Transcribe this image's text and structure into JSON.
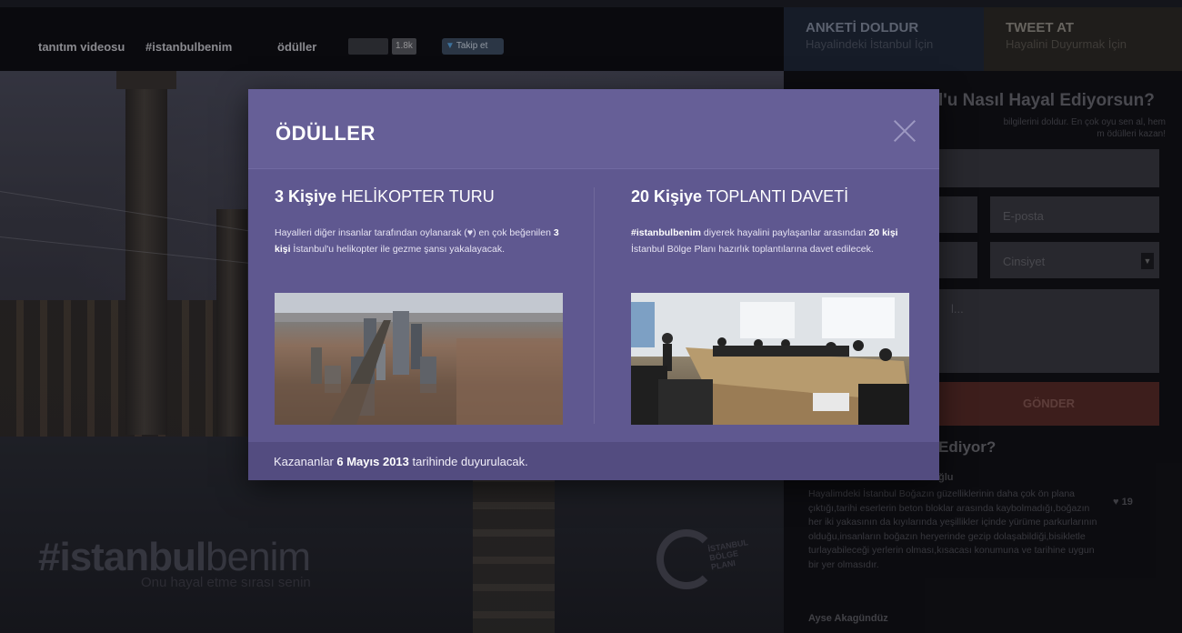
{
  "topbar": {
    "nav": [
      "tanıtım videosu",
      "#istanbulbenim",
      "ödüller"
    ],
    "like_count": "1.8k",
    "follow_label": "Takip et"
  },
  "rightpanel": {
    "tabs": [
      {
        "title": "ANKETİ DOLDUR",
        "subtitle": "Hayalindeki İstanbul İçin"
      },
      {
        "title": "TWEET AT",
        "subtitle": "Hayalini Duyurmak İçin"
      }
    ],
    "heading": "l'u Nasıl Hayal Ediyorsun?",
    "desc": "bilgilerini doldur. En çok oyu sen al, hem\nm ödülleri kazan!",
    "email_placeholder": "E-posta",
    "gender_placeholder": "Cinsiyet",
    "message_placeholder": "l...",
    "send_label": "GÖNDER",
    "section_title": "Ediyor?",
    "comment_author": "ğlu",
    "comment_text": "Hayalimdeki İstanbul Boğazın güzelliklerinin daha çok ön plana çıktığı,tarihi eserlerin beton bloklar arasında kaybolmadığı,boğazın her iki yakasının da kıyılarında yeşillikler içinde yürüme parkurlarının olduğu,insanların boğazın heryerinde gezip dolaşabildiği,bisikletle turlayabileceği yerlerin olması,kısacası konumuna ve tarihine uygun bir yer olmasıdır.",
    "comment_likes": "19",
    "next_author": "Ayse Akagündüz"
  },
  "brand": {
    "part1": "#istanbul",
    "part2": "benim",
    "tagline": "Onu hayal etme sırası senin",
    "logo_text": "İSTANBUL BÖLGE PLANI"
  },
  "modal": {
    "title": "ÖDÜLLER",
    "prizes": [
      {
        "count": "3 Kişiye",
        "name": "HELİKOPTER TURU",
        "text_before": "Hayalleri diğer insanlar tarafından oylanarak (♥) en çok beğenilen ",
        "text_bold": "3 kişi",
        "text_after": " İstanbul'u helikopter ile gezme şansı yakalayacak."
      },
      {
        "count": "20 Kişiye",
        "name": "TOPLANTI DAVETİ",
        "text_bold1": "#istanbulbenim",
        "text_mid": " diyerek hayalini paylaşanlar arasından ",
        "text_bold2": "20 kişi",
        "text_after": "  İstanbul Bölge Planı hazırlık toplantılarına davet edilecek."
      }
    ],
    "footer_before": "Kazananlar ",
    "footer_bold": "6 Mayıs 2013",
    "footer_after": " tarihinde duyurulacak."
  },
  "colors": {
    "modal_bg": "#5f5890",
    "modal_footer": "#534c80",
    "send_button": "#c0392b"
  }
}
